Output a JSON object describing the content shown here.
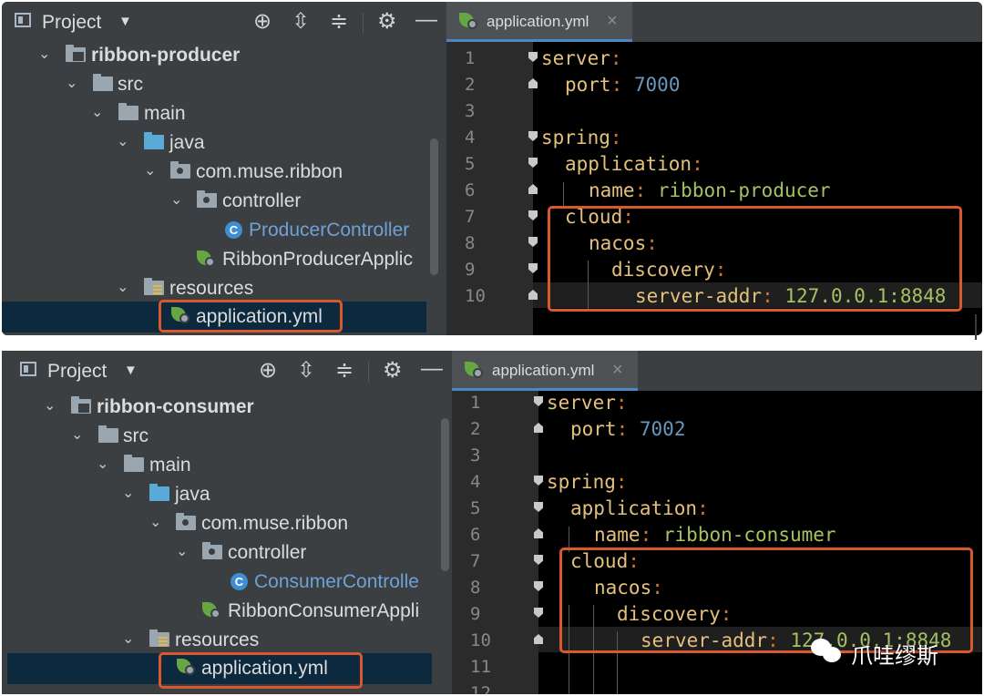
{
  "colors": {
    "accent_highlight": "#d9582f",
    "selection": "#0d293e",
    "tab_underline": "#4a88c7",
    "class_blue": "#6fa1d6"
  },
  "top": {
    "project": {
      "title": "Project"
    },
    "tree": [
      {
        "label": "ribbon-producer",
        "icon": "module-folder-icon"
      },
      {
        "label": "src",
        "icon": "folder-icon"
      },
      {
        "label": "main",
        "icon": "folder-icon"
      },
      {
        "label": "java",
        "icon": "source-folder-icon"
      },
      {
        "label": "com.muse.ribbon",
        "icon": "package-icon"
      },
      {
        "label": "controller",
        "icon": "package-icon"
      },
      {
        "label": "ProducerController",
        "icon": "class-icon"
      },
      {
        "label": "RibbonProducerApplic",
        "icon": "spring-boot-app-icon"
      },
      {
        "label": "resources",
        "icon": "resources-folder-icon"
      },
      {
        "label": "application.yml",
        "icon": "spring-yml-icon"
      }
    ],
    "tab": {
      "label": "application.yml"
    },
    "lines": [
      "1",
      "2",
      "3",
      "4",
      "5",
      "6",
      "7",
      "8",
      "9",
      "10"
    ],
    "code": {
      "l1_key": "server",
      "l1_colon": ":",
      "l2_key": "port",
      "l2_colon": ":",
      "l2_val": "7000",
      "l4_key": "spring",
      "l4_colon": ":",
      "l5_key": "application",
      "l5_colon": ":",
      "l6_key": "name",
      "l6_colon": ":",
      "l6_val": "ribbon-producer",
      "l7_key": "cloud",
      "l7_colon": ":",
      "l8_key": "nacos",
      "l8_colon": ":",
      "l9_key": "discovery",
      "l9_colon": ":",
      "l10_key": "server-addr",
      "l10_colon": ":",
      "l10_val": "127.0.0.1:8848"
    }
  },
  "bottom": {
    "project": {
      "title": "Project"
    },
    "tree": [
      {
        "label": "ribbon-consumer",
        "icon": "module-folder-icon"
      },
      {
        "label": "src",
        "icon": "folder-icon"
      },
      {
        "label": "main",
        "icon": "folder-icon"
      },
      {
        "label": "java",
        "icon": "source-folder-icon"
      },
      {
        "label": "com.muse.ribbon",
        "icon": "package-icon"
      },
      {
        "label": "controller",
        "icon": "package-icon"
      },
      {
        "label": "ConsumerControlle",
        "icon": "class-icon"
      },
      {
        "label": "RibbonConsumerAppli",
        "icon": "spring-boot-app-icon"
      },
      {
        "label": "resources",
        "icon": "resources-folder-icon"
      },
      {
        "label": "application.yml",
        "icon": "spring-yml-icon"
      }
    ],
    "tab": {
      "label": "application.yml"
    },
    "lines": [
      "1",
      "2",
      "3",
      "4",
      "5",
      "6",
      "7",
      "8",
      "9",
      "10",
      "11",
      "12"
    ],
    "code": {
      "l1_key": "server",
      "l1_colon": ":",
      "l2_key": "port",
      "l2_colon": ":",
      "l2_val": "7002",
      "l4_key": "spring",
      "l4_colon": ":",
      "l5_key": "application",
      "l5_colon": ":",
      "l6_key": "name",
      "l6_colon": ":",
      "l6_val": "ribbon-consumer",
      "l7_key": "cloud",
      "l7_colon": ":",
      "l8_key": "nacos",
      "l8_colon": ":",
      "l9_key": "discovery",
      "l9_colon": ":",
      "l10_key": "server-addr",
      "l10_colon": ":",
      "l10_val": "127.0.0.1:8848"
    }
  },
  "watermark": {
    "text": "爪哇缪斯"
  }
}
